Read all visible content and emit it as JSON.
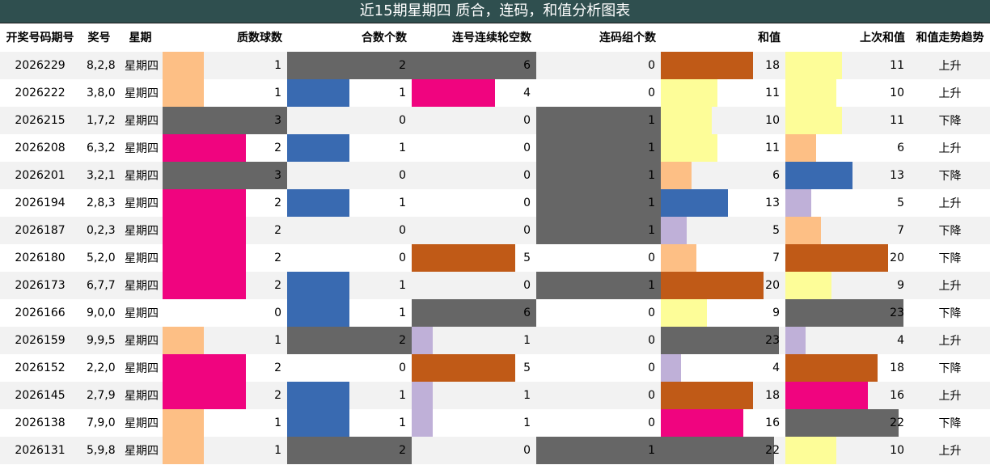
{
  "title": "近15期星期四 质合，连码，和值分析图表",
  "columns": [
    "开奖号码期号",
    "奖号",
    "星期",
    "质数球数",
    "合数个数",
    "连号连续轮空数",
    "连码组个数",
    "和值",
    "上次和值",
    "和值走势趋势"
  ],
  "colors": {
    "peach": "#fdbf85",
    "pink": "#f0047f",
    "gray": "#666666",
    "blue": "#396ab1",
    "orange": "#c05a17",
    "lavender": "#bfb0d8",
    "yellow": "#fdfd98"
  },
  "chart_data": {
    "type": "table",
    "title": "近15期星期四 质合，连码，和值分析图表",
    "rows": [
      {
        "period": "2026229",
        "numbers": "8,2,8",
        "weekday": "星期四",
        "prime": 1,
        "composite": 2,
        "consec_gap": 6,
        "consec_groups": 0,
        "sum": 18,
        "prev_sum": 11,
        "trend": "上升"
      },
      {
        "period": "2026222",
        "numbers": "3,8,0",
        "weekday": "星期四",
        "prime": 1,
        "composite": 1,
        "consec_gap": 4,
        "consec_groups": 0,
        "sum": 11,
        "prev_sum": 10,
        "trend": "上升"
      },
      {
        "period": "2026215",
        "numbers": "1,7,2",
        "weekday": "星期四",
        "prime": 3,
        "composite": 0,
        "consec_gap": 0,
        "consec_groups": 1,
        "sum": 10,
        "prev_sum": 11,
        "trend": "下降"
      },
      {
        "period": "2026208",
        "numbers": "6,3,2",
        "weekday": "星期四",
        "prime": 2,
        "composite": 1,
        "consec_gap": 0,
        "consec_groups": 1,
        "sum": 11,
        "prev_sum": 6,
        "trend": "上升"
      },
      {
        "period": "2026201",
        "numbers": "3,2,1",
        "weekday": "星期四",
        "prime": 3,
        "composite": 0,
        "consec_gap": 0,
        "consec_groups": 1,
        "sum": 6,
        "prev_sum": 13,
        "trend": "下降"
      },
      {
        "period": "2026194",
        "numbers": "2,8,3",
        "weekday": "星期四",
        "prime": 2,
        "composite": 1,
        "consec_gap": 0,
        "consec_groups": 1,
        "sum": 13,
        "prev_sum": 5,
        "trend": "上升"
      },
      {
        "period": "2026187",
        "numbers": "0,2,3",
        "weekday": "星期四",
        "prime": 2,
        "composite": 0,
        "consec_gap": 0,
        "consec_groups": 1,
        "sum": 5,
        "prev_sum": 7,
        "trend": "下降"
      },
      {
        "period": "2026180",
        "numbers": "5,2,0",
        "weekday": "星期四",
        "prime": 2,
        "composite": 0,
        "consec_gap": 5,
        "consec_groups": 0,
        "sum": 7,
        "prev_sum": 20,
        "trend": "下降"
      },
      {
        "period": "2026173",
        "numbers": "6,7,7",
        "weekday": "星期四",
        "prime": 2,
        "composite": 1,
        "consec_gap": 0,
        "consec_groups": 1,
        "sum": 20,
        "prev_sum": 9,
        "trend": "上升"
      },
      {
        "period": "2026166",
        "numbers": "9,0,0",
        "weekday": "星期四",
        "prime": 0,
        "composite": 1,
        "consec_gap": 6,
        "consec_groups": 0,
        "sum": 9,
        "prev_sum": 23,
        "trend": "下降"
      },
      {
        "period": "2026159",
        "numbers": "9,9,5",
        "weekday": "星期四",
        "prime": 1,
        "composite": 2,
        "consec_gap": 1,
        "consec_groups": 0,
        "sum": 23,
        "prev_sum": 4,
        "trend": "上升"
      },
      {
        "period": "2026152",
        "numbers": "2,2,0",
        "weekday": "星期四",
        "prime": 2,
        "composite": 0,
        "consec_gap": 5,
        "consec_groups": 0,
        "sum": 4,
        "prev_sum": 18,
        "trend": "下降"
      },
      {
        "period": "2026145",
        "numbers": "2,7,9",
        "weekday": "星期四",
        "prime": 2,
        "composite": 1,
        "consec_gap": 1,
        "consec_groups": 0,
        "sum": 18,
        "prev_sum": 16,
        "trend": "上升"
      },
      {
        "period": "2026138",
        "numbers": "7,9,0",
        "weekday": "星期四",
        "prime": 1,
        "composite": 1,
        "consec_gap": 1,
        "consec_groups": 0,
        "sum": 16,
        "prev_sum": 22,
        "trend": "下降"
      },
      {
        "period": "2026131",
        "numbers": "5,9,8",
        "weekday": "星期四",
        "prime": 1,
        "composite": 2,
        "consec_gap": 0,
        "consec_groups": 1,
        "sum": 22,
        "prev_sum": 10,
        "trend": "上升"
      }
    ]
  }
}
